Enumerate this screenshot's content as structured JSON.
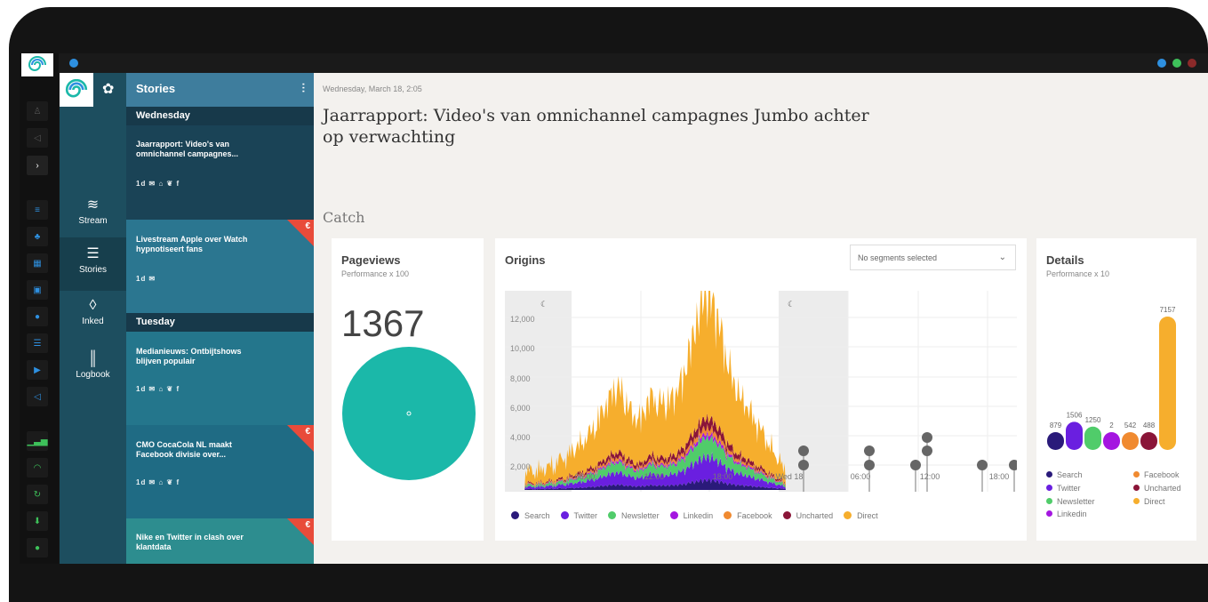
{
  "window": {
    "controls": [
      "#2e90e0",
      "#3ec15a",
      "#8b2a2a"
    ]
  },
  "nav": {
    "items": [
      {
        "label": "Stream",
        "icon": "stream-icon"
      },
      {
        "label": "Stories",
        "icon": "list-icon"
      },
      {
        "label": "Inked",
        "icon": "drop-icon"
      },
      {
        "label": "Logbook",
        "icon": "bar-chart-icon"
      }
    ]
  },
  "stories": {
    "title": "Stories",
    "days": [
      "Wednesday",
      "Tuesday"
    ],
    "cards": [
      {
        "title": "Jaarrapport: Video's van omnichannel campagnes...",
        "meta": "1d ✉ ⌂ ❦ f"
      },
      {
        "title": "Livestream Apple over Watch hypnotiseert fans",
        "meta": "1d ✉",
        "euro": "€"
      },
      {
        "title": "Medianieuws: Ontbijtshows blijven populair",
        "meta": "1d ✉ ⌂ ❦ f"
      },
      {
        "title": "CMO CocaCola NL maakt Facebook divisie over...",
        "meta": "1d ✉ ⌂ ❦ f",
        "euro": "€"
      },
      {
        "title": "Nike en Twitter in clash over klantdata",
        "meta": "",
        "euro": "€"
      }
    ]
  },
  "article": {
    "date": "Wednesday, March 18, 2:05",
    "title": "Jaarrapport: Video's van omnichannel campagnes Jumbo achter op verwachting",
    "section": "Catch"
  },
  "pageviews": {
    "title": "Pageviews",
    "subtitle": "Performance x 100",
    "value": "1367",
    "color": "#1bb8a9"
  },
  "origins": {
    "title": "Origins",
    "select_placeholder": "No segments selected",
    "y_ticks": [
      "12,000",
      "10,000",
      "8,000",
      "6,000",
      "4,000",
      "2,000"
    ],
    "x_ticks": [
      "06:00",
      "12:00",
      "18:00",
      "Wed 18",
      "06:00",
      "12:00",
      "18:00"
    ]
  },
  "details": {
    "title": "Details",
    "subtitle": "Performance x 10"
  },
  "chart_data": [
    {
      "type": "area",
      "series": [
        {
          "name": "Search",
          "color": "#2a1a7a"
        },
        {
          "name": "Twitter",
          "color": "#6a1fe0"
        },
        {
          "name": "Newsletter",
          "color": "#50cc6a"
        },
        {
          "name": "Linkedin",
          "color": "#a416e0"
        },
        {
          "name": "Facebook",
          "color": "#f08a30"
        },
        {
          "name": "Uncharted",
          "color": "#8a1538"
        },
        {
          "name": "Direct",
          "color": "#f6ae2d"
        }
      ],
      "ylim": [
        0,
        13000
      ]
    },
    {
      "type": "bar",
      "categories": [
        "Search",
        "Twitter",
        "Newsletter",
        "Linkedin",
        "Facebook",
        "Uncharted",
        "Direct"
      ],
      "values": [
        879,
        1506,
        1250,
        2,
        542,
        488,
        7157
      ],
      "colors": [
        "#2a1a7a",
        "#6a1fe0",
        "#50cc6a",
        "#a416e0",
        "#f08a30",
        "#8a1538",
        "#f6ae2d"
      ],
      "labels": [
        "879",
        "1506",
        "1250",
        "2",
        "542",
        "488",
        "7157"
      ]
    }
  ]
}
